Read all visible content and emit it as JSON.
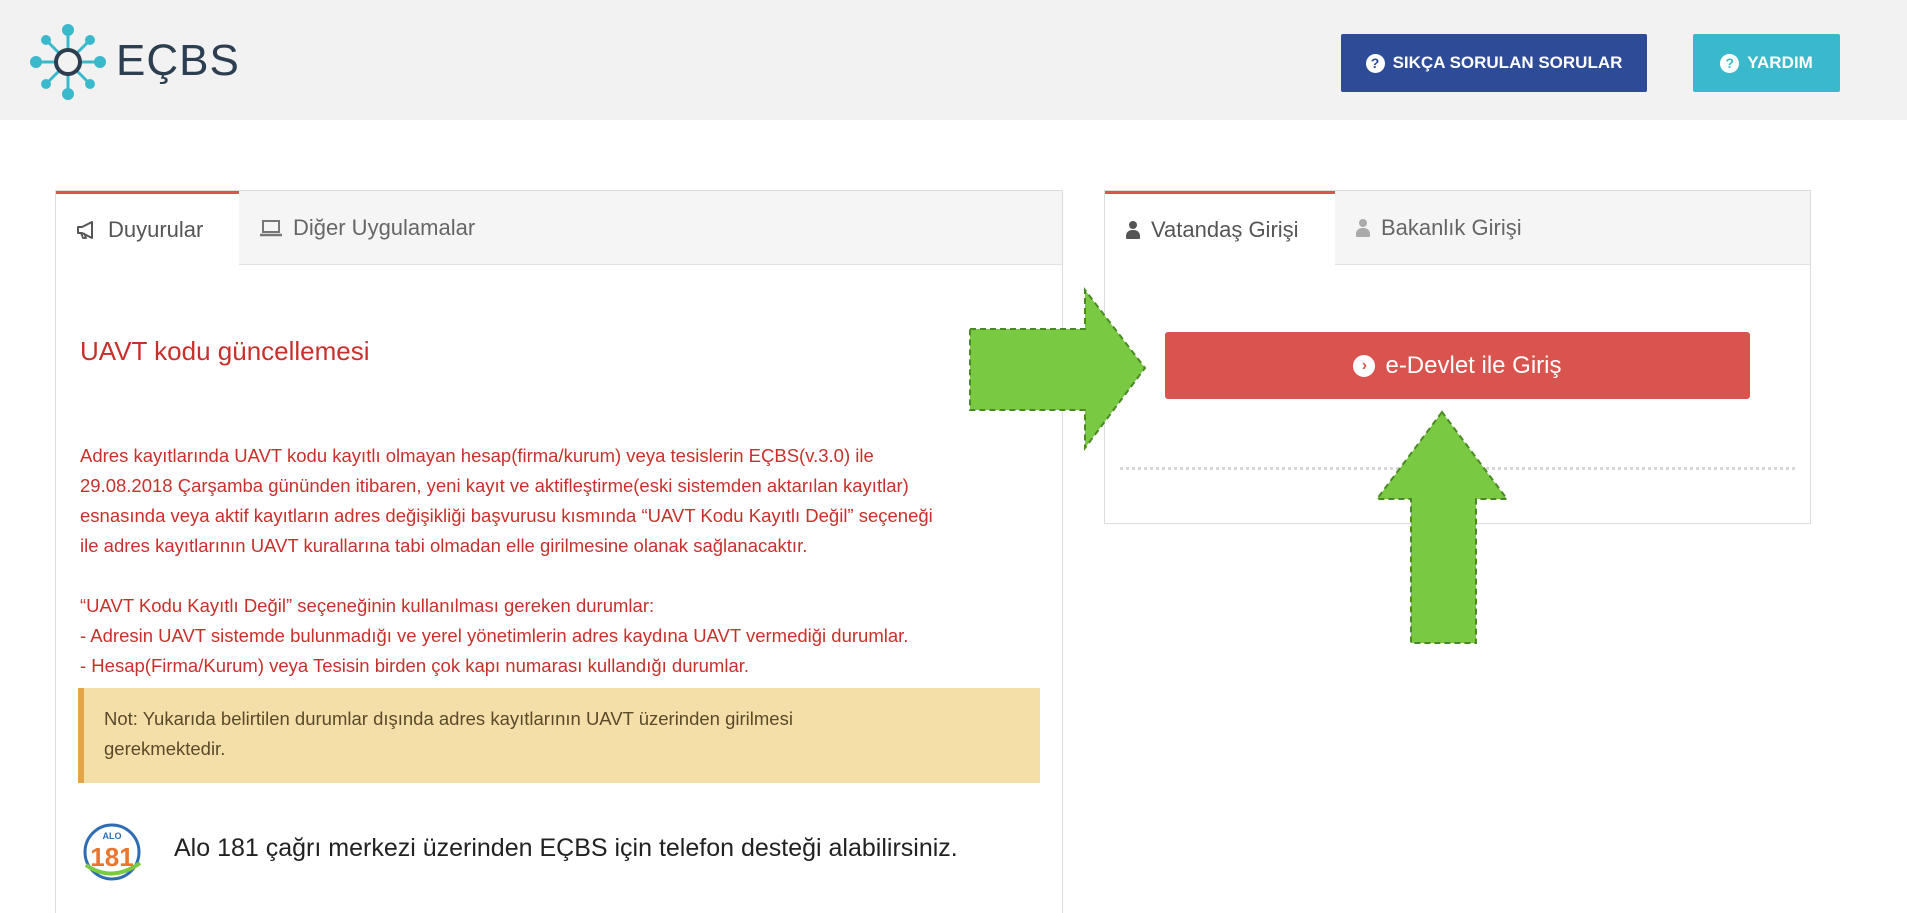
{
  "header": {
    "brand": "EÇBS",
    "faq_label": "SIKÇA SORULAN SORULAR",
    "help_label": "YARDIM"
  },
  "left_panel": {
    "tabs": [
      {
        "label": "Duyurular",
        "icon": "megaphone-icon",
        "active": true
      },
      {
        "label": "Diğer Uygulamalar",
        "icon": "laptop-icon",
        "active": false
      }
    ],
    "announcement": {
      "title": "UAVT kodu güncellemesi",
      "body_lines": [
        "Adres kayıtlarında UAVT kodu kayıtlı olmayan hesap(firma/kurum) veya tesislerin EÇBS(v.3.0) ile",
        "29.08.2018 Çarşamba gününden itibaren, yeni kayıt ve aktifleştirme(eski sistemden aktarılan kayıtlar)",
        "esnasında veya aktif kayıtların adres değişikliği başvurusu kısmında “UAVT Kodu Kayıtlı Değil” seçeneği",
        "ile adres kayıtlarının UAVT kurallarına tabi olmadan elle girilmesine olanak sağlanacaktır."
      ],
      "conditions_lines": [
        "“UAVT Kodu Kayıtlı Değil” seçeneğinin kullanılması gereken durumlar:",
        "- Adresin UAVT sistemde bulunmadığı ve yerel yönetimlerin adres kaydına UAVT vermediği durumlar.",
        "- Hesap(Firma/Kurum) veya Tesisin birden çok kapı numarası kullandığı durumlar."
      ],
      "note_lines": [
        "Not: Yukarıda belirtilen durumlar dışında adres kayıtlarının UAVT üzerinden girilmesi",
        "gerekmektedir."
      ]
    },
    "alo": {
      "logo_top": "ALO",
      "logo_number": "181",
      "text": "Alo 181 çağrı merkezi üzerinden EÇBS için telefon desteği alabilirsiniz."
    }
  },
  "right_panel": {
    "tabs": [
      {
        "label": "Vatandaş Girişi",
        "icon": "user-icon",
        "active": true
      },
      {
        "label": "Bakanlık Girişi",
        "icon": "user-icon",
        "active": false
      }
    ],
    "login_button": "e-Devlet ile Giriş"
  },
  "colors": {
    "accent_red": "#d9534f",
    "faq_blue": "#2e4b97",
    "help_teal": "#3bb9cc",
    "arrow_green": "#7ac943",
    "note_bg": "#f5dfa8"
  }
}
